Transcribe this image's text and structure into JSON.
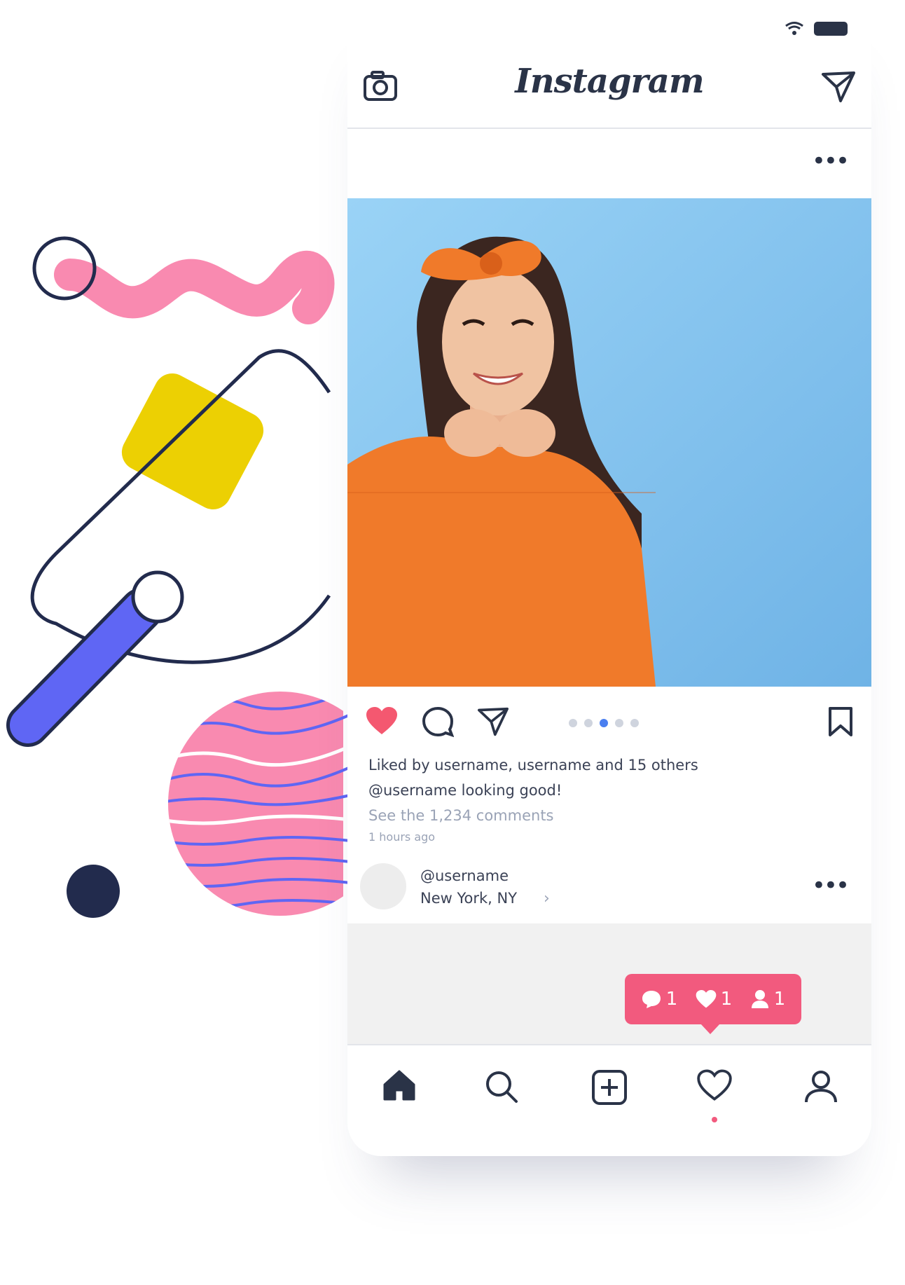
{
  "header": {
    "logo_text": "Instagram"
  },
  "post": {
    "actions": {
      "carousel_dot_count": 5,
      "carousel_active_index": 2
    },
    "likes_text": "Liked by username, username and 15 others",
    "caption_text": "@username looking good!",
    "comments_link": "See the 1,234 comments",
    "time_ago": "1 hours ago"
  },
  "user": {
    "name": "@username",
    "location": "New York, NY"
  },
  "notification": {
    "comments": "1",
    "likes": "1",
    "followers": "1"
  },
  "colors": {
    "accent": "#f25a7e",
    "heart": "#f45870",
    "ink": "#2a3347",
    "active_dot": "#4a7ff0"
  },
  "bottom_nav": [
    "home-icon",
    "search-icon",
    "add-post-icon",
    "activity-heart-icon",
    "profile-icon"
  ]
}
